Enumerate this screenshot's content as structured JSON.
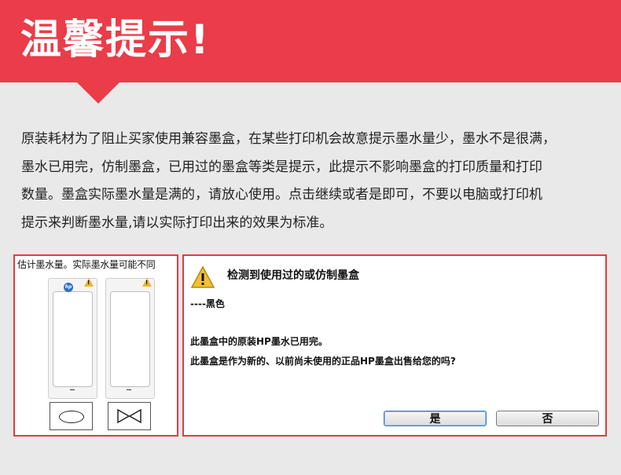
{
  "banner": {
    "title": "温馨提示!"
  },
  "notice": {
    "lines": [
      "原装耗材为了阻止买家使用兼容墨盒，在某些打印机会故意提示墨水量少，墨水不是很满，",
      "墨水已用完，仿制墨盒，已用过的墨盒等类是提示，此提示不影响墨盒的打印质量和打印",
      "数量。墨盒实际墨水量是满的，请放心使用。点击继续或者是即可，不要以电脑或打印机",
      "提示来判断墨水量,请以实际打印出来的效果为标准。"
    ]
  },
  "ink_status": {
    "header": "估计墨水量。实际墨水量可能不同",
    "cartridges": [
      {
        "logo": "hp-logo",
        "warning": true,
        "level": "--",
        "icon": "oval-icon"
      },
      {
        "logo": null,
        "warning": true,
        "level": "--",
        "icon": "bowtie-icon"
      }
    ]
  },
  "dialog": {
    "title": "检测到使用过的或仿制墨盒",
    "color_line": "----黑色",
    "message_1": "此墨盒中的原装HP墨水已用完。",
    "message_2": "此墨盒是作为新的、以前尚未使用的正品HP墨盒出售给您的吗?",
    "yes_label": "是",
    "no_label": "否",
    "warning_icon": "warning-icon"
  },
  "colors": {
    "accent": "#ea3c49",
    "background": "#e9e9e9",
    "warning": "#e8b82a",
    "hp_blue": "#2b6fc4"
  }
}
